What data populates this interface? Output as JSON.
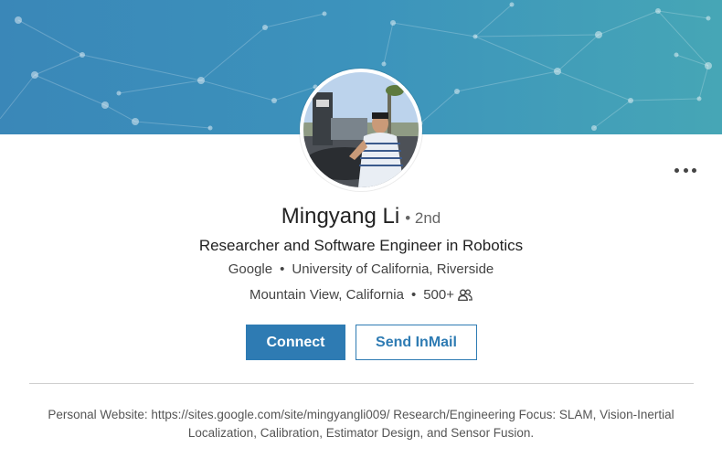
{
  "profile": {
    "name": "Mingyang Li",
    "degree": "• 2nd",
    "headline": "Researcher and Software Engineer in Robotics",
    "company": "Google",
    "school": "University of California, Riverside",
    "location": "Mountain View, California",
    "connections": "500+",
    "separator": "•"
  },
  "actions": {
    "connect_label": "Connect",
    "inmail_label": "Send InMail"
  },
  "summary": "Personal Website: https://sites.google.com/site/mingyangli009/ Research/Engineering Focus: SLAM, Vision-Inertial Localization, Calibration, Estimator Design, and Sensor Fusion.",
  "icons": {
    "more": "more-options-icon",
    "connections": "people-icon"
  },
  "colors": {
    "accent": "#2e7bb3",
    "banner_start": "#3a87b8",
    "banner_end": "#46a6b6"
  }
}
